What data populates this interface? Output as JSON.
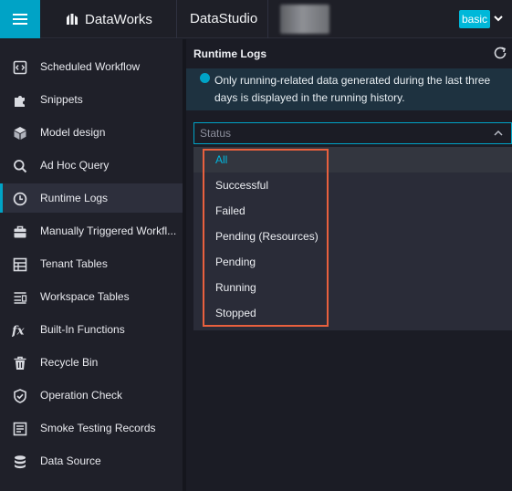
{
  "app": {
    "menu_icon": "hamburger-menu-icon",
    "brand": "DataWorks",
    "brand_icon": "dataworks-logo-icon",
    "module": "DataStudio",
    "edition_badge": "basic",
    "accent_color": "#00a3c6"
  },
  "sidebar": {
    "items": [
      {
        "label": "Scheduled Workflow",
        "icon": "code-file-icon"
      },
      {
        "label": "Snippets",
        "icon": "puzzle-icon"
      },
      {
        "label": "Model design",
        "icon": "cube-icon"
      },
      {
        "label": "Ad Hoc Query",
        "icon": "search-icon"
      },
      {
        "label": "Runtime Logs",
        "icon": "clock-icon",
        "active": true
      },
      {
        "label": "Manually Triggered Workfl...",
        "icon": "briefcase-icon"
      },
      {
        "label": "Tenant Tables",
        "icon": "table-icon"
      },
      {
        "label": "Workspace Tables",
        "icon": "list-table-icon"
      },
      {
        "label": "Built-In Functions",
        "icon": "function-icon"
      },
      {
        "label": "Recycle Bin",
        "icon": "trash-icon"
      },
      {
        "label": "Operation Check",
        "icon": "shield-check-icon"
      },
      {
        "label": "Smoke Testing Records",
        "icon": "records-icon"
      },
      {
        "label": "Data Source",
        "icon": "database-icon"
      }
    ]
  },
  "panel": {
    "title": "Runtime Logs",
    "refresh_icon": "refresh-icon",
    "notice": "Only running-related data generated during the last three days is displayed in the running history.",
    "notice_icon": "info-icon",
    "status_filter": {
      "placeholder": "Status",
      "expanded": true,
      "options": [
        "All",
        "Successful",
        "Failed",
        "Pending (Resources)",
        "Pending",
        "Running",
        "Stopped"
      ],
      "selected": "All"
    }
  }
}
